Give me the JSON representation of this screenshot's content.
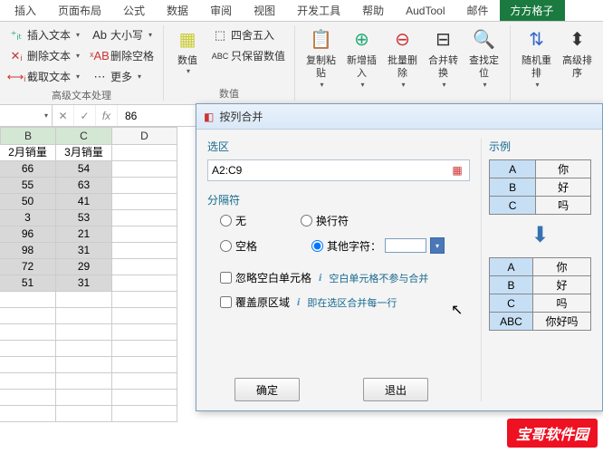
{
  "ribbon": {
    "tabs": [
      "插入",
      "页面布局",
      "公式",
      "数据",
      "审阅",
      "视图",
      "开发工具",
      "帮助",
      "AudTool",
      "邮件",
      "方方格子"
    ],
    "active_tab": "方方格子",
    "group1": {
      "insert_text": "插入文本",
      "delete_text": "删除文本",
      "trim_text": "截取文本",
      "case": "大小写",
      "delete_space": "删除空格",
      "more": "更多",
      "label": "高级文本处理"
    },
    "group2": {
      "label": "数值",
      "round": "四舍五入",
      "keep_num": "只保留数值"
    },
    "group3": {
      "copy_paste": "复制粘贴",
      "new_insert": "新增插入",
      "batch_del": "批量删除",
      "merge_conv": "合并转换",
      "find_loc": "查找定位"
    },
    "group4": {
      "random": "随机重排",
      "advanced": "高级排序"
    }
  },
  "formula_bar": {
    "name_box": "",
    "fx": "fx",
    "value": "86"
  },
  "grid": {
    "cols": [
      "B",
      "C",
      "D"
    ],
    "headerB": "2月销量",
    "headerC": "3月销量",
    "rows": [
      {
        "b": "66",
        "c": "54"
      },
      {
        "b": "55",
        "c": "63"
      },
      {
        "b": "50",
        "c": "41"
      },
      {
        "b": "3",
        "c": "53"
      },
      {
        "b": "96",
        "c": "21"
      },
      {
        "b": "98",
        "c": "31"
      },
      {
        "b": "72",
        "c": "29"
      },
      {
        "b": "51",
        "c": "31"
      }
    ]
  },
  "dialog": {
    "title": "按列合并",
    "selection_label": "选区",
    "selection_value": "A2:C9",
    "separator_label": "分隔符",
    "radio_none": "无",
    "radio_newline": "换行符",
    "radio_space": "空格",
    "radio_other": "其他字符：",
    "other_value": "",
    "check_ignore_blank": "忽略空白单元格",
    "hint_ignore": "空白单元格不参与合并",
    "check_overwrite": "覆盖原区域",
    "hint_overwrite": "即在选区合并每一行",
    "ok": "确定",
    "cancel": "退出",
    "example_label": "示例",
    "ex_top": [
      [
        "A",
        "你"
      ],
      [
        "B",
        "好"
      ],
      [
        "C",
        "吗"
      ]
    ],
    "ex_bottom": [
      [
        "A",
        "你"
      ],
      [
        "B",
        "好"
      ],
      [
        "C",
        "吗"
      ],
      [
        "ABC",
        "你好吗"
      ]
    ]
  },
  "watermark": "宝哥软件园"
}
